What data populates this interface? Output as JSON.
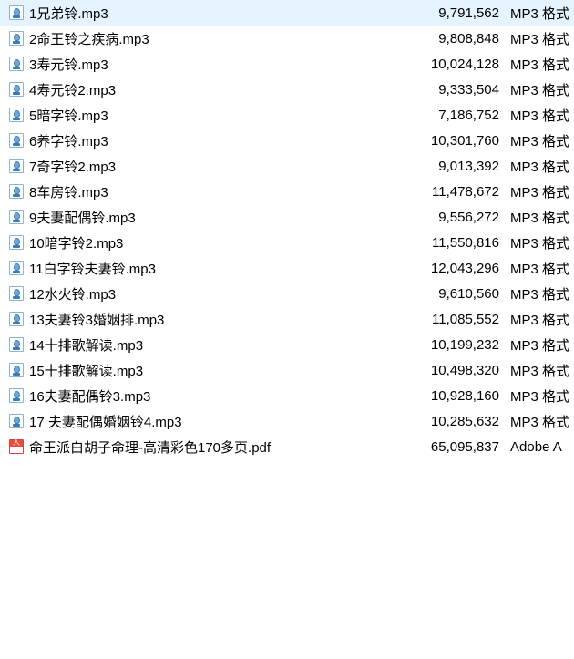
{
  "files": [
    {
      "name": "1兄弟铃.mp3",
      "size": "9,791,562",
      "type": "MP3 格式",
      "icon": "mp3"
    },
    {
      "name": "2命王铃之疾病.mp3",
      "size": "9,808,848",
      "type": "MP3 格式",
      "icon": "mp3"
    },
    {
      "name": "3寿元铃.mp3",
      "size": "10,024,128",
      "type": "MP3 格式",
      "icon": "mp3"
    },
    {
      "name": "4寿元铃2.mp3",
      "size": "9,333,504",
      "type": "MP3 格式",
      "icon": "mp3"
    },
    {
      "name": "5暗字铃.mp3",
      "size": "7,186,752",
      "type": "MP3 格式",
      "icon": "mp3"
    },
    {
      "name": "6养字铃.mp3",
      "size": "10,301,760",
      "type": "MP3 格式",
      "icon": "mp3"
    },
    {
      "name": "7奇字铃2.mp3",
      "size": "9,013,392",
      "type": "MP3 格式",
      "icon": "mp3"
    },
    {
      "name": "8车房铃.mp3",
      "size": "11,478,672",
      "type": "MP3 格式",
      "icon": "mp3"
    },
    {
      "name": "9夫妻配偶铃.mp3",
      "size": "9,556,272",
      "type": "MP3 格式",
      "icon": "mp3"
    },
    {
      "name": "10暗字铃2.mp3",
      "size": "11,550,816",
      "type": "MP3 格式",
      "icon": "mp3"
    },
    {
      "name": "11白字铃夫妻铃.mp3",
      "size": "12,043,296",
      "type": "MP3 格式",
      "icon": "mp3"
    },
    {
      "name": "12水火铃.mp3",
      "size": "9,610,560",
      "type": "MP3 格式",
      "icon": "mp3"
    },
    {
      "name": "13夫妻铃3婚姻排.mp3",
      "size": "11,085,552",
      "type": "MP3 格式",
      "icon": "mp3"
    },
    {
      "name": "14十排歌解读.mp3",
      "size": "10,199,232",
      "type": "MP3 格式",
      "icon": "mp3"
    },
    {
      "name": "15十排歌解读.mp3",
      "size": "10,498,320",
      "type": "MP3 格式",
      "icon": "mp3"
    },
    {
      "name": "16夫妻配偶铃3.mp3",
      "size": "10,928,160",
      "type": "MP3 格式",
      "icon": "mp3"
    },
    {
      "name": "17 夫妻配偶婚姻铃4.mp3",
      "size": "10,285,632",
      "type": "MP3 格式",
      "icon": "mp3"
    },
    {
      "name": "命王派白胡子命理-高清彩色170多页.pdf",
      "size": "65,095,837",
      "type": "Adobe A",
      "icon": "pdf"
    }
  ]
}
